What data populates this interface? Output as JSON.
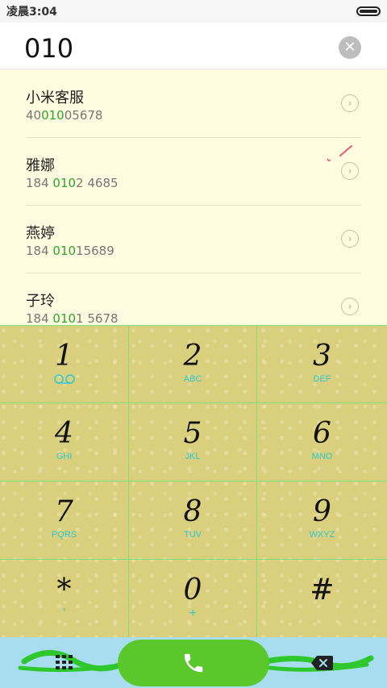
{
  "status_bar": {
    "time": "凌晨3:04"
  },
  "search": {
    "query": "010"
  },
  "contacts": [
    {
      "name": "小米客服",
      "number_pre": "40",
      "number_match": "010",
      "number_post": "05678"
    },
    {
      "name": "雅娜",
      "number_pre": "184 ",
      "number_match": "010",
      "number_post": "2 4685"
    },
    {
      "name": "燕婷",
      "number_pre": "184 ",
      "number_match": "010",
      "number_post": "15689"
    },
    {
      "name": "子玲",
      "number_pre": "184 ",
      "number_match": "010",
      "number_post": "1 5678"
    }
  ],
  "keypad": {
    "keys": [
      {
        "digit": "1",
        "letters": "",
        "sub": "voicemail-icon"
      },
      {
        "digit": "2",
        "letters": "ABC"
      },
      {
        "digit": "3",
        "letters": "DEF"
      },
      {
        "digit": "4",
        "letters": "GHI"
      },
      {
        "digit": "5",
        "letters": "JKL"
      },
      {
        "digit": "6",
        "letters": "MNO"
      },
      {
        "digit": "7",
        "letters": "PQRS"
      },
      {
        "digit": "8",
        "letters": "TUV"
      },
      {
        "digit": "9",
        "letters": "WXYZ"
      },
      {
        "digit": "*",
        "letters": "'"
      },
      {
        "digit": "0",
        "letters": "+"
      },
      {
        "digit": "#",
        "letters": ""
      }
    ]
  },
  "icons": {
    "clear": "clear-icon",
    "detail": "chevron-right-icon",
    "keypad_toggle": "dialpad-icon",
    "call": "phone-icon",
    "backspace": "backspace-icon"
  },
  "colors": {
    "match_highlight": "#2aa82a",
    "call_button": "#5ac82a",
    "key_letters": "#2fc9d0",
    "bottom_bar": "#a8ddef",
    "keypad_bg": "#d9cf7c"
  }
}
